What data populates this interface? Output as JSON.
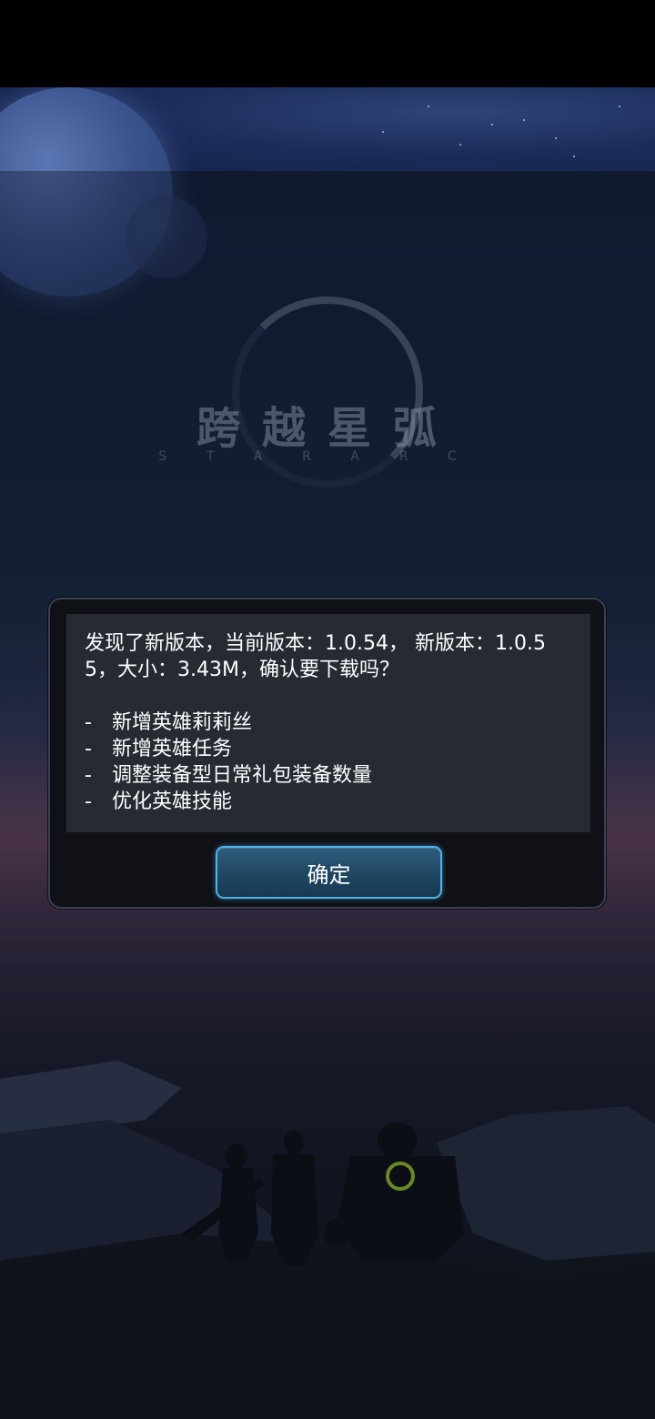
{
  "game": {
    "logo_title": "跨越星弧",
    "logo_subtitle": "STARARC"
  },
  "update_dialog": {
    "message": "发现了新版本，当前版本：1.0.54， 新版本：1.0.55，大小：3.43M，确认要下载吗？",
    "changelog": [
      "新增英雄莉莉丝",
      "新增英雄任务",
      "调整装备型日常礼包装备数量",
      "优化英雄技能"
    ],
    "bullet": "-",
    "confirm_label": "确定"
  },
  "colors": {
    "dialog_bg": "#0f1117",
    "panel_bg": "#262a33",
    "button_border": "#4fb2e8",
    "button_fill": "#1f4661"
  }
}
